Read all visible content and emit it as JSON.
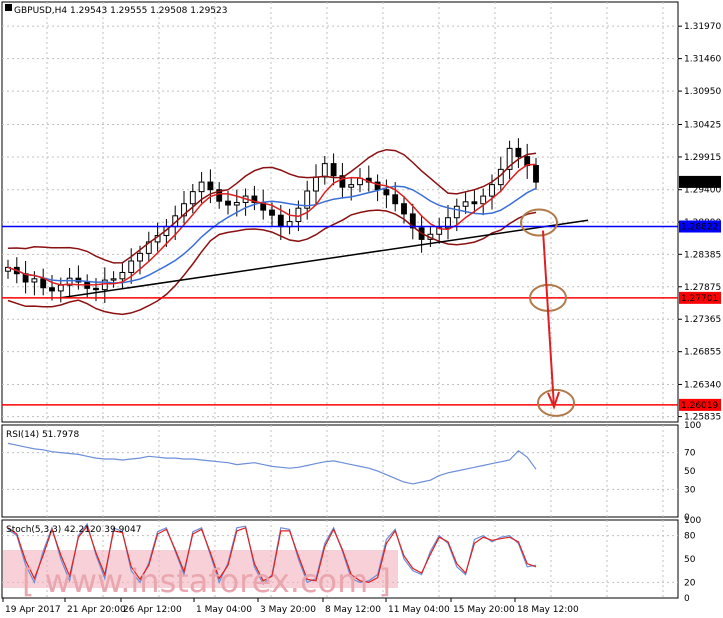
{
  "header": {
    "symbol": "GBPUSD,H4",
    "ohlc": "1.29543 1.29555 1.29508 1.29523"
  },
  "rsi_label": "RSI(14) 51.7978",
  "stoch_label": "Stoch(5,3,3) 42.2120 39.9047",
  "watermark": "www.instaforex.com",
  "colors": {
    "bg": "#ffffff",
    "grid": "#c0c0c0",
    "candle": "#000000",
    "bands": "#8b1010",
    "ma_fast": "#dd1f1f",
    "ma_slow": "#3a6fd8",
    "support_blue": "#0000ff",
    "level_red": "#ff0000",
    "target": "#b07a4a",
    "arrow": "#e02020",
    "osc_blue": "#6b8fd8",
    "osc_red": "#e02020",
    "watermark_band": "#f2b3bd"
  },
  "chart_data": [
    {
      "type": "candlestick",
      "title": "GBPUSD,H4 1.29543 1.29555 1.29508 1.29523",
      "ylim": [
        1.2575,
        1.3235
      ],
      "y_ticks": [
        "1.31970",
        "1.31460",
        "1.30950",
        "1.30425",
        "1.29915",
        "1.29400",
        "1.28890",
        "1.28385",
        "1.27875",
        "1.27365",
        "1.26855",
        "1.26340",
        "1.25835"
      ],
      "y_tick_values": [
        1.3197,
        1.3146,
        1.3095,
        1.30425,
        1.29915,
        1.294,
        1.2889,
        1.28385,
        1.27875,
        1.27365,
        1.26855,
        1.2634,
        1.25835
      ],
      "price_markers": [
        {
          "label": "1.29523",
          "value": 1.29523,
          "color": "#000000"
        },
        {
          "label": "1.28822",
          "value": 1.28822,
          "color": "#0000ff"
        },
        {
          "label": "1.27701",
          "value": 1.27701,
          "color": "#ff0000"
        },
        {
          "label": "1.26019",
          "value": 1.26019,
          "color": "#ff0000"
        }
      ],
      "close": [
        1.2818,
        1.2808,
        1.2795,
        1.28,
        1.2786,
        1.2781,
        1.279,
        1.2801,
        1.2795,
        1.2785,
        1.2783,
        1.2798,
        1.28,
        1.281,
        1.2828,
        1.284,
        1.2858,
        1.2868,
        1.2882,
        1.2899,
        1.2918,
        1.2937,
        1.2952,
        1.294,
        1.2922,
        1.2916,
        1.292,
        1.293,
        1.292,
        1.2908,
        1.29,
        1.2882,
        1.289,
        1.2911,
        1.2938,
        1.296,
        1.2981,
        1.2962,
        1.2944,
        1.2948,
        1.2958,
        1.2952,
        1.294,
        1.2932,
        1.2918,
        1.2902,
        1.288,
        1.2862,
        1.287,
        1.288,
        1.2896,
        1.2914,
        1.2921,
        1.2918,
        1.293,
        1.2948,
        1.2972,
        1.3005,
        1.2992,
        1.2978,
        1.2952
      ]
    },
    {
      "type": "line",
      "title": "RSI(14) 51.7978",
      "ylim": [
        0,
        100
      ],
      "y_ticks": [
        "100",
        "70",
        "50",
        "30",
        "0"
      ],
      "y_tick_values": [
        100,
        70,
        50,
        30,
        0
      ],
      "values": [
        80,
        78,
        76,
        74,
        73,
        71,
        70,
        69,
        68,
        66,
        64,
        63,
        63,
        62,
        63,
        64,
        66,
        65,
        64,
        64,
        63,
        63,
        62,
        61,
        60,
        59,
        57,
        58,
        59,
        57,
        55,
        54,
        53,
        54,
        56,
        58,
        60,
        61,
        59,
        57,
        55,
        53,
        50,
        46,
        42,
        38,
        36,
        38,
        40,
        45,
        48,
        50,
        52,
        54,
        56,
        58,
        60,
        62,
        72,
        65,
        52
      ]
    },
    {
      "type": "line",
      "title": "Stoch(5,3,3) 42.2120 39.9047",
      "ylim": [
        0,
        100
      ],
      "y_ticks": [
        "100",
        "80",
        "50",
        "20",
        "0"
      ],
      "y_tick_values": [
        100,
        80,
        50,
        20,
        0
      ],
      "x_labels": [
        "19 Apr 2017",
        "21 Apr 20:00",
        "26 Apr 12:00",
        "1 May 04:00",
        "3 May 20:00",
        "8 May 12:00",
        "11 May 04:00",
        "15 May 20:00",
        "18 May 12:00"
      ],
      "series": [
        {
          "values": [
            88,
            80,
            42,
            20,
            60,
            90,
            50,
            22,
            80,
            95,
            55,
            25,
            90,
            85,
            35,
            20,
            45,
            85,
            90,
            60,
            30,
            85,
            90,
            55,
            20,
            45,
            90,
            92,
            40,
            18,
            30,
            90,
            88,
            50,
            20,
            25,
            70,
            90,
            60,
            25,
            20,
            22,
            30,
            75,
            88,
            50,
            35,
            30,
            60,
            80,
            70,
            40,
            30,
            75,
            80,
            72,
            78,
            80,
            70,
            40,
            42
          ]
        },
        {
          "values": [
            90,
            82,
            48,
            25,
            55,
            88,
            55,
            28,
            78,
            92,
            58,
            30,
            86,
            84,
            40,
            24,
            42,
            82,
            88,
            62,
            34,
            82,
            88,
            58,
            25,
            42,
            86,
            90,
            44,
            22,
            28,
            86,
            86,
            54,
            24,
            22,
            66,
            88,
            62,
            30,
            22,
            20,
            26,
            70,
            86,
            54,
            38,
            32,
            56,
            78,
            72,
            44,
            32,
            70,
            78,
            74,
            76,
            78,
            72,
            44,
            40
          ]
        }
      ]
    }
  ],
  "annotations": [
    "1.28822 support",
    "1.27701 target",
    "1.26019 target"
  ]
}
